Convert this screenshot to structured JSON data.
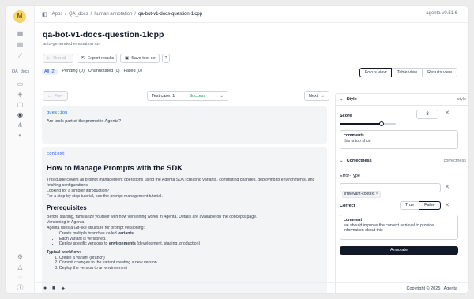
{
  "app": {
    "logo_letter": "M",
    "version": "agenta v0.51.6",
    "section_label": "QA_docs"
  },
  "breadcrumb": [
    "Apps",
    "QA_docs",
    "human annotation",
    "qa-bot-v1-docs-question-1lcpp"
  ],
  "page": {
    "title": "qa-bot-v1-docs-question-1lcpp",
    "subtitle": "auto-generated evaluation run"
  },
  "toolbar": {
    "run_all": "Run all",
    "export": "Export results",
    "save": "Save test set"
  },
  "filters": [
    "All (2)",
    "Pending (0)",
    "Unannotated (0)",
    "Failed (0)"
  ],
  "view_tabs": [
    "Focus view",
    "Table view",
    "Results view"
  ],
  "nav": {
    "prev": "Prev",
    "next": "Next",
    "testcase": "Test case: 1",
    "status": "Success"
  },
  "question": {
    "label": "question",
    "text": "Are tools part of the prompt in Agenta?"
  },
  "context": {
    "label": "context",
    "h1": "How to Manage Prompts with the SDK",
    "intro": "This guide covers all prompt management operations using the Agenta SDK: creating variants, committing changes, deploying to environments, and fetching configurations.",
    "simpler": "Looking for a simpler introduction?",
    "tutorial": "For a step-by-step tutorial, see the prompt management tutorial.",
    "h2": "Prerequisites",
    "prereq": "Before starting, familiarize yourself with how versioning works in Agenta. Details are available on the concepts page.",
    "versioning_title": "Versioning in Agenta",
    "versioning_text": "Agenta uses a Git-like structure for prompt versioning:",
    "bullets": [
      "Create multiple branches called ",
      "Each variant is versioned.",
      "Deploy specific versions to "
    ],
    "bullet_bold": [
      "variants",
      "",
      "environments"
    ],
    "bullet_tail": [
      "",
      "",
      " (development, staging, production)"
    ],
    "workflow_title": "Typical workflow:",
    "workflow": [
      "Create a variant (branch)",
      "Commit changes to the variant creating a new version",
      "Deploy the version to an environment"
    ]
  },
  "annotations": {
    "style": {
      "name": "Style",
      "tag": "style",
      "score_label": "Score",
      "score_value": "3",
      "score_fraction": 0.75,
      "comment_title": "comments",
      "comment_text": "this is too short"
    },
    "correctness": {
      "name": "Correctness",
      "tag": "correctness",
      "error_label": "Error-Type",
      "error_chip": "irrelevant-context",
      "correct_label": "Correct",
      "true_label": "True",
      "false_label": "False",
      "comment_title": "comment",
      "comment_text": "we should improve the context retrieval to provide information about this"
    },
    "annotate_label": "Annotate"
  },
  "footer": {
    "copyright": "Copyright © 2025 | Agenta"
  },
  "colors": {
    "accent": "#111827",
    "success": "#16a34a",
    "link": "#2563eb"
  }
}
